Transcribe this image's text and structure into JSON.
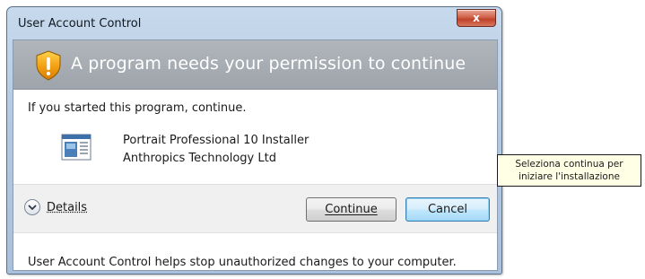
{
  "window": {
    "title": "User Account Control",
    "close_symbol": "x"
  },
  "header": {
    "message": "A program needs your permission to continue",
    "icon": "shield-warning-icon"
  },
  "body": {
    "intro": "If you started this program, continue.",
    "program": {
      "name": "Portrait Professional 10 Installer",
      "publisher": "Anthropics Technology Ltd",
      "icon": "installer-program-icon"
    }
  },
  "actions": {
    "details_label": "Details",
    "continue_label": "Continue",
    "cancel_label": "Cancel"
  },
  "footer": {
    "text": "User Account Control helps stop unauthorized changes to your computer."
  },
  "callout": {
    "line1": "Seleziona continua per",
    "line2": "iniziare l'installazione"
  },
  "colors": {
    "header_band": "#a7adb4",
    "cancel_border": "#3c7fb1",
    "close_red": "#c7462f",
    "shield_orange": "#f0a11a"
  }
}
